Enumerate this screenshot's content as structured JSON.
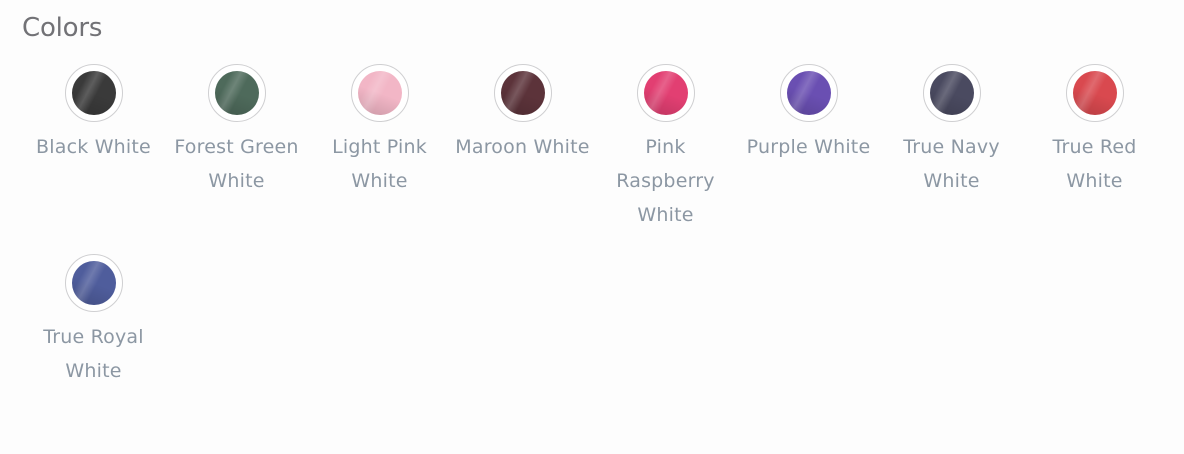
{
  "section": {
    "title": "Colors"
  },
  "swatches": [
    {
      "label": "Black White",
      "color": "#3a3a3a"
    },
    {
      "label": "Forest Green White",
      "color": "#4e6a5b"
    },
    {
      "label": "Light Pink White",
      "color": "#f2b6c6"
    },
    {
      "label": "Maroon White",
      "color": "#5c333a"
    },
    {
      "label": "Pink Raspberry White",
      "color": "#e23f72"
    },
    {
      "label": "Purple White",
      "color": "#6a4fb2"
    },
    {
      "label": "True Navy White",
      "color": "#4a4a60"
    },
    {
      "label": "True Red White",
      "color": "#d9494f"
    },
    {
      "label": "True Royal White",
      "color": "#4f5d9c"
    }
  ]
}
